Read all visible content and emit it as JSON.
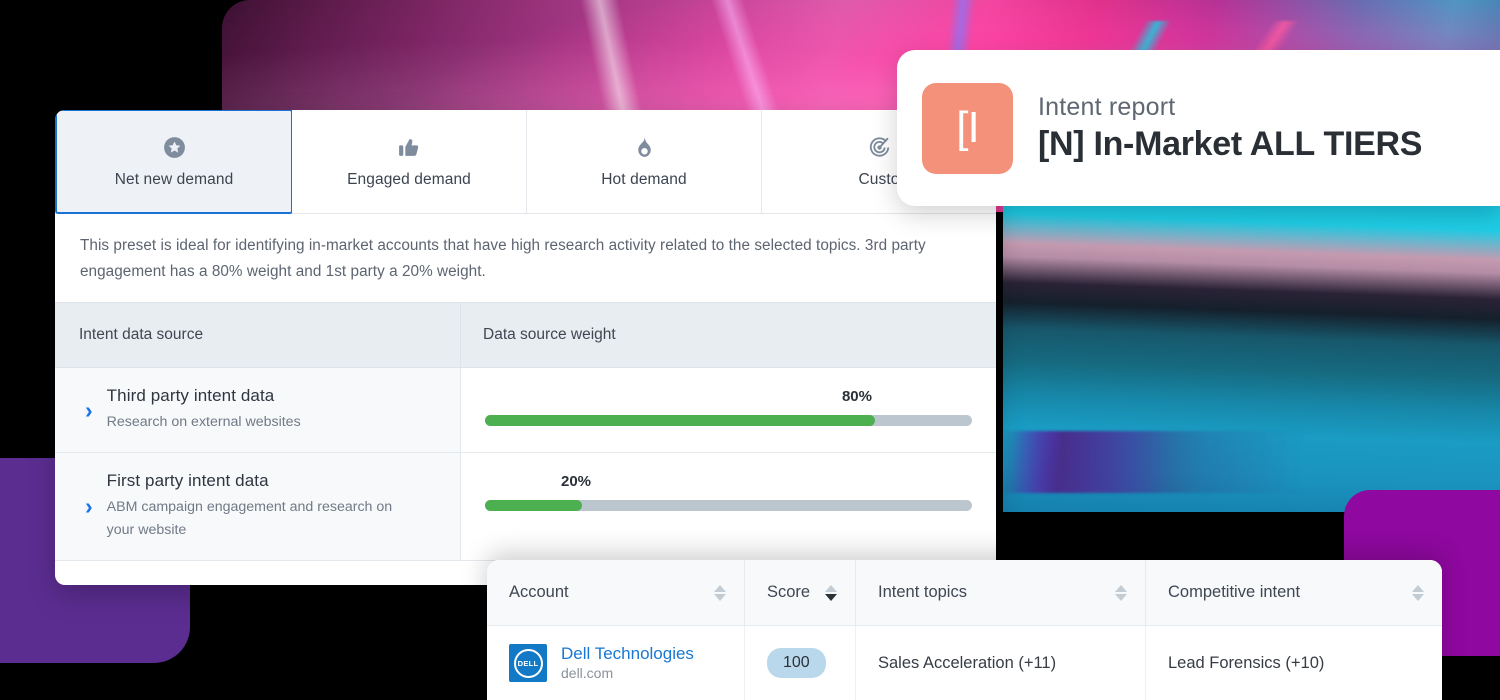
{
  "preset": {
    "tabs": [
      {
        "label": "Net new demand",
        "icon": "star-badge-icon",
        "active": true
      },
      {
        "label": "Engaged demand",
        "icon": "thumbs-up-icon",
        "active": false
      },
      {
        "label": "Hot demand",
        "icon": "flame-icon",
        "active": false
      },
      {
        "label": "Custo",
        "icon": "target-radar-icon",
        "active": false
      }
    ],
    "description": "This preset is ideal for identifying in-market accounts that have high research activity related to the selected topics. 3rd party engagement has a 80% weight and 1st party a 20% weight.",
    "table": {
      "columns": [
        "Intent data source",
        "Data source weight"
      ],
      "rows": [
        {
          "title": "Third party intent data",
          "subtitle": "Research on external websites",
          "weight_label": "80%",
          "weight_pct": 80
        },
        {
          "title": "First party intent data",
          "subtitle": "ABM campaign engagement and research on your website",
          "weight_label": "20%",
          "weight_pct": 20
        }
      ]
    }
  },
  "intent_report": {
    "icon_glyph": "[I",
    "kicker": "Intent report",
    "title": "[N] In-Market ALL TIERS"
  },
  "accounts": {
    "columns": [
      {
        "label": "Account",
        "sort": "none"
      },
      {
        "label": "Score",
        "sort": "desc"
      },
      {
        "label": "Intent topics",
        "sort": "none"
      },
      {
        "label": "Competitive intent",
        "sort": "none"
      }
    ],
    "rows": [
      {
        "logo_text": "DELL",
        "name": "Dell Technologies",
        "url": "dell.com",
        "score": "100",
        "intent_topics": "Sales Acceleration (+11)",
        "competitive_intent": "Lead Forensics (+10)"
      }
    ]
  },
  "colors": {
    "accent_blue": "#1a73d4",
    "link_blue": "#1877d2",
    "bar_green": "#4caf50",
    "bar_track": "#bcc6cf",
    "chip_icon_bg": "#f4917a",
    "score_pill_bg": "#b9d8ec",
    "purple_left": "#5b2d91",
    "purple_right": "#8f089f"
  }
}
